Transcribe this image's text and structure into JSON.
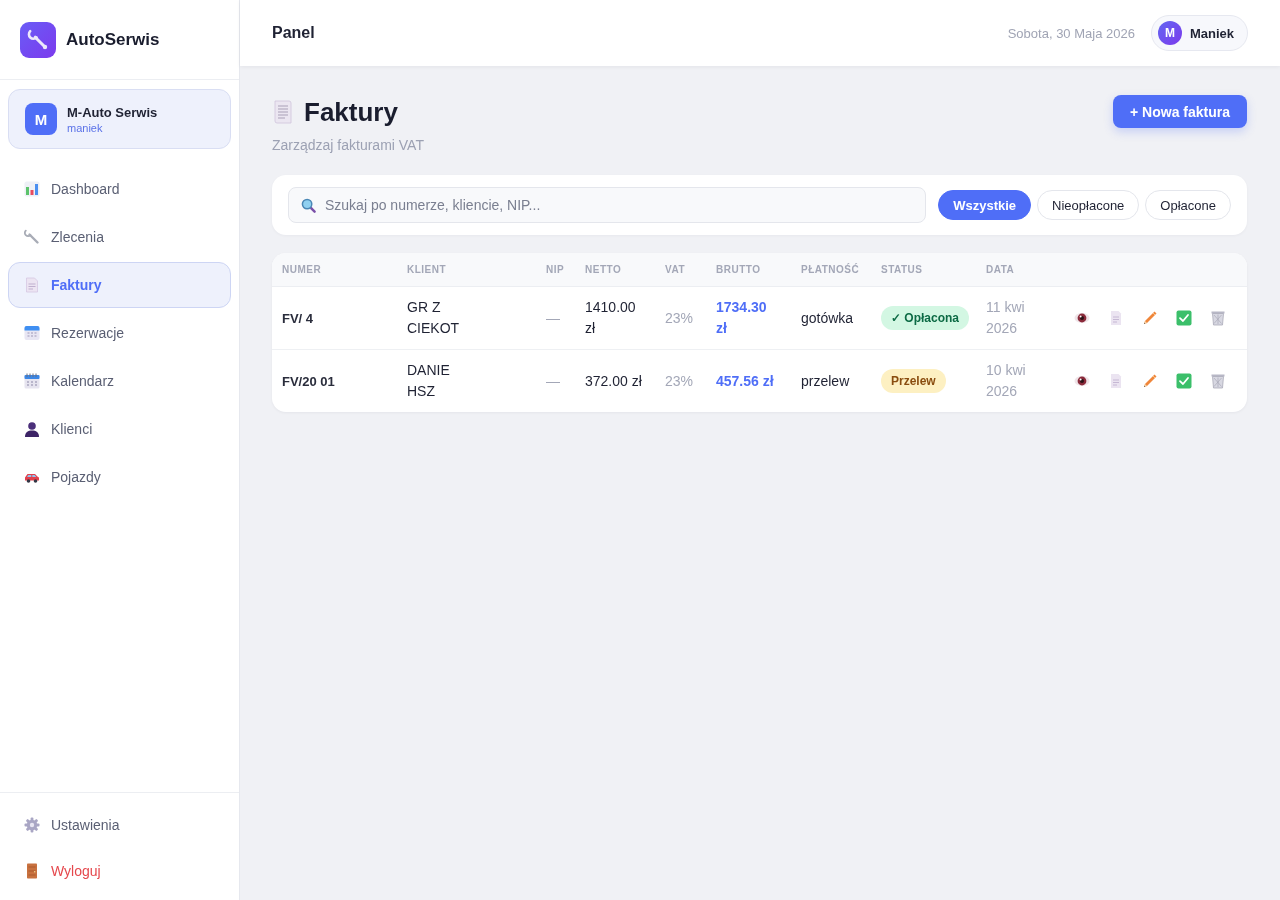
{
  "sidebar": {
    "brand": {
      "name": "AutoSerwis"
    },
    "workshop": {
      "initial": "M",
      "name": "M-Auto Serwis",
      "user": "maniek"
    },
    "nav": [
      {
        "label": "Dashboard",
        "selected": false
      },
      {
        "label": "Zlecenia",
        "selected": false
      },
      {
        "label": "Faktury",
        "selected": true
      },
      {
        "label": "Rezerwacje",
        "selected": false
      },
      {
        "label": "Kalendarz",
        "selected": false
      },
      {
        "label": "Klienci",
        "selected": false
      },
      {
        "label": "Pojazdy",
        "selected": false
      }
    ],
    "footer": [
      {
        "label": "Ustawienia",
        "kind": "normal"
      },
      {
        "label": "Wyloguj",
        "kind": "danger"
      }
    ]
  },
  "header": {
    "title": "Panel",
    "date": "Sobota, 30 Maja 2026",
    "user": {
      "initial": "M",
      "name": "Maniek"
    }
  },
  "page": {
    "title": "Faktury",
    "subtitle": "Zarządzaj fakturami VAT",
    "new_button": "+ Nowa faktura"
  },
  "filters": {
    "search": {
      "placeholder": "Szukaj po numerze, kliencie, NIP..."
    },
    "chips": [
      {
        "label": "Wszystkie",
        "selected": true
      },
      {
        "label": "Nieopłacone",
        "selected": false
      },
      {
        "label": "Opłacone",
        "selected": false
      }
    ]
  },
  "table": {
    "columns": [
      "NUMER",
      "KLIENT",
      "NIP",
      "NETTO",
      "VAT",
      "BRUTTO",
      "PŁATNOŚĆ",
      "STATUS",
      "DATA"
    ],
    "rows": [
      {
        "number": "FV/ 4",
        "client": "GR Z CIEKOT",
        "nip": "—",
        "net": "1410.00 zł",
        "vat": "23%",
        "gross": "1734.30 zł",
        "payment": "gotówka",
        "status": {
          "label": "✓ Opłacona",
          "kind": "paid"
        },
        "date": "11 kwi 2026"
      },
      {
        "number": "FV/20 01",
        "client": "DANIE HSZ",
        "nip": "—",
        "net": "372.00 zł",
        "vat": "23%",
        "gross": "457.56 zł",
        "payment": "przelew",
        "status": {
          "label": "Przelew",
          "kind": "pending"
        },
        "date": "10 kwi 2026"
      }
    ]
  }
}
